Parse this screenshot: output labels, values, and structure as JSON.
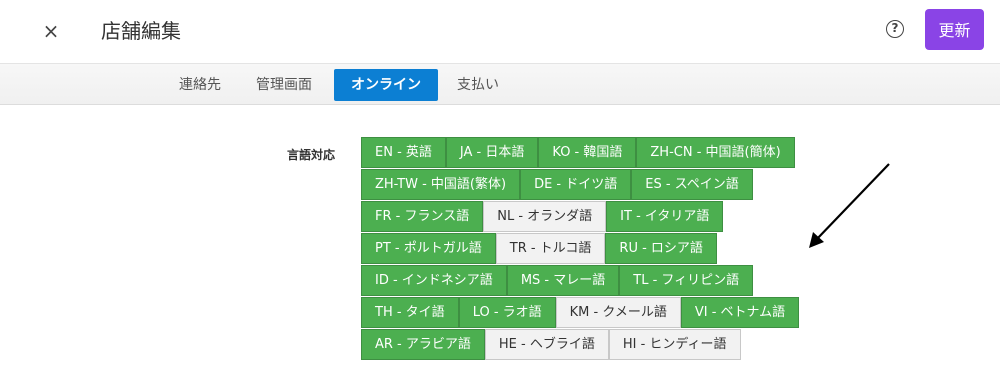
{
  "header": {
    "close_icon": "×",
    "title": "店舗編集",
    "help_icon": "?",
    "update_label": "更新",
    "accent_color": "#8a44e6"
  },
  "tabs": [
    {
      "label": "連絡先",
      "active": false
    },
    {
      "label": "管理画面",
      "active": false
    },
    {
      "label": "オンライン",
      "active": true
    },
    {
      "label": "支払い",
      "active": false
    }
  ],
  "languages": {
    "label": "言語対応",
    "rows": [
      [
        {
          "label": "EN - 英語",
          "enabled": true
        },
        {
          "label": "JA - 日本語",
          "enabled": true
        },
        {
          "label": "KO - 韓国語",
          "enabled": true
        },
        {
          "label": "ZH-CN - 中国語(簡体)",
          "enabled": true
        }
      ],
      [
        {
          "label": "ZH-TW - 中国語(繁体)",
          "enabled": true
        },
        {
          "label": "DE - ドイツ語",
          "enabled": true
        },
        {
          "label": "ES - スペイン語",
          "enabled": true
        }
      ],
      [
        {
          "label": "FR - フランス語",
          "enabled": true
        },
        {
          "label": "NL - オランダ語",
          "enabled": false
        },
        {
          "label": "IT - イタリア語",
          "enabled": true
        }
      ],
      [
        {
          "label": "PT - ポルトガル語",
          "enabled": true
        },
        {
          "label": "TR - トルコ語",
          "enabled": false
        },
        {
          "label": "RU - ロシア語",
          "enabled": true
        }
      ],
      [
        {
          "label": "ID - インドネシア語",
          "enabled": true
        },
        {
          "label": "MS - マレー語",
          "enabled": true
        },
        {
          "label": "TL - フィリピン語",
          "enabled": true
        }
      ],
      [
        {
          "label": "TH - タイ語",
          "enabled": true
        },
        {
          "label": "LO - ラオ語",
          "enabled": true
        },
        {
          "label": "KM - クメール語",
          "enabled": false
        },
        {
          "label": "VI - ベトナム語",
          "enabled": true
        }
      ],
      [
        {
          "label": "AR - アラビア語",
          "enabled": true
        },
        {
          "label": "HE - ヘブライ語",
          "enabled": false
        },
        {
          "label": "HI - ヒンディー語",
          "enabled": false
        }
      ]
    ],
    "enabled_color": "#4caf50",
    "disabled_color": "#f2f2f2"
  },
  "annotation": {
    "icon": "arrow-pointing-down-left"
  }
}
